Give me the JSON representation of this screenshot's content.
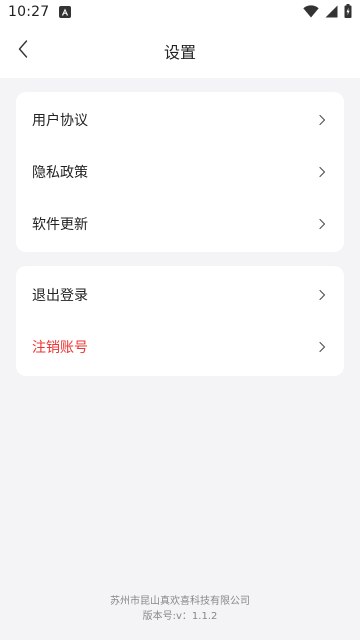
{
  "status_bar": {
    "time": "10:27",
    "icons": [
      "notification-a-icon",
      "wifi-icon",
      "signal-icon",
      "battery-charging-icon"
    ]
  },
  "header": {
    "title": "设置",
    "back_icon": "back-chevron-icon"
  },
  "settings": {
    "group1": [
      {
        "label": "用户协议"
      },
      {
        "label": "隐私政策"
      },
      {
        "label": "软件更新"
      }
    ],
    "group2": [
      {
        "label": "退出登录"
      },
      {
        "label": "注销账号",
        "color": "#ee3333"
      }
    ]
  },
  "footer": {
    "company": "苏州市昆山真欢喜科技有限公司",
    "version": "版本号:v：1.1.2"
  },
  "colors": {
    "background": "#f4f4f6",
    "card": "#ffffff",
    "danger": "#ee3333"
  }
}
